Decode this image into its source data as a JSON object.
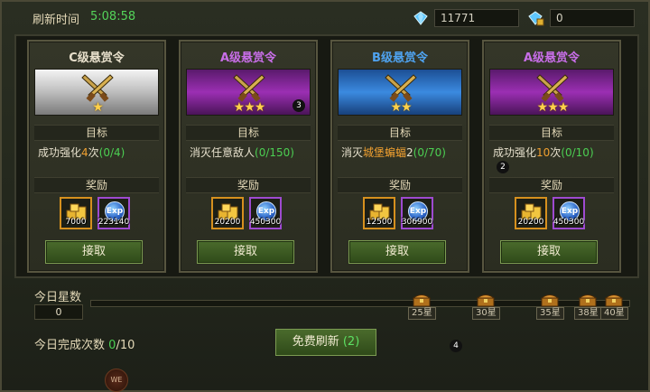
{
  "header": {
    "refresh_label": "刷新时间",
    "refresh_time": "5:08:58",
    "diamonds": "11771",
    "bound_diamonds": "0"
  },
  "cards": [
    {
      "title": "C级悬赏令",
      "title_color": "#e8e0cc",
      "banner": "c",
      "stars": "★",
      "goal_label": "目标",
      "goal_prefix": "成功强化",
      "goal_num": "4",
      "goal_suffix": "次",
      "goal_prog": "(0/4)",
      "reward_label": "奖励",
      "gold": "7000",
      "exp": "223140",
      "exp_icon_label": "Exp",
      "accept": "接取"
    },
    {
      "title": "A级悬赏令",
      "title_color": "#c86ee8",
      "banner": "a",
      "stars": "★★★",
      "goal_label": "目标",
      "goal_prefix": "消灭任意敌人",
      "goal_num": "",
      "goal_suffix": "",
      "goal_prog": "(0/150)",
      "reward_label": "奖励",
      "gold": "20200",
      "exp": "450300",
      "exp_icon_label": "Exp",
      "accept": "接取"
    },
    {
      "title": "B级悬赏令",
      "title_color": "#4fa3f0",
      "banner": "b",
      "stars": "★★",
      "goal_label": "目标",
      "goal_prefix": "消灭",
      "goal_num": "城堡蝙蝠",
      "goal_suffix": "2",
      "goal_prog": "(0/70)",
      "reward_label": "奖励",
      "gold": "12500",
      "exp": "306900",
      "exp_icon_label": "Exp",
      "accept": "接取"
    },
    {
      "title": "A级悬赏令",
      "title_color": "#c86ee8",
      "banner": "a",
      "stars": "★★★",
      "goal_label": "目标",
      "goal_prefix": "成功强化",
      "goal_num": "10",
      "goal_suffix": "次",
      "goal_prog": "(0/10)",
      "reward_label": "奖励",
      "gold": "20200",
      "exp": "450300",
      "exp_icon_label": "Exp",
      "accept": "接取"
    }
  ],
  "badges": [
    "3",
    "2",
    "4"
  ],
  "daily": {
    "stars_label": "今日星数",
    "stars_value": "0",
    "milestones": [
      "25星",
      "30星",
      "35星",
      "38星",
      "40星"
    ],
    "done_label": "今日完成次数",
    "done_cur": "0",
    "done_total": "/10",
    "refresh_label": "免费刷新",
    "refresh_count": "(2)"
  },
  "bottom_icon_label": "WE",
  "colors": {
    "accent_green": "#4ccf52",
    "gold_border": "#d6901e",
    "exp_border": "#9e4ad0"
  }
}
